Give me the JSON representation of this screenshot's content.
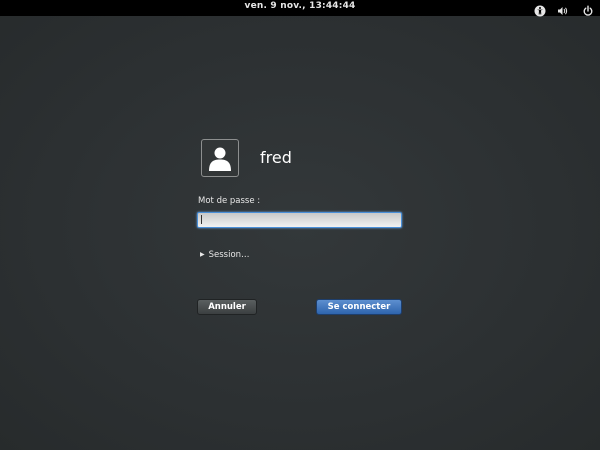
{
  "topbar": {
    "clock": "ven.  9 nov., 13:44:44",
    "icons": [
      "accessibility-icon",
      "volume-icon",
      "power-icon"
    ]
  },
  "login": {
    "username": "fred",
    "password_label": "Mot de passe :",
    "password_value": "",
    "session_label": "Session…",
    "cancel_label": "Annuler",
    "connect_label": "Se connecter"
  },
  "colors": {
    "background": "#2e3436",
    "topbar": "#000000",
    "focus_ring": "#4a90d9",
    "connect_button": "#3a71b8"
  }
}
